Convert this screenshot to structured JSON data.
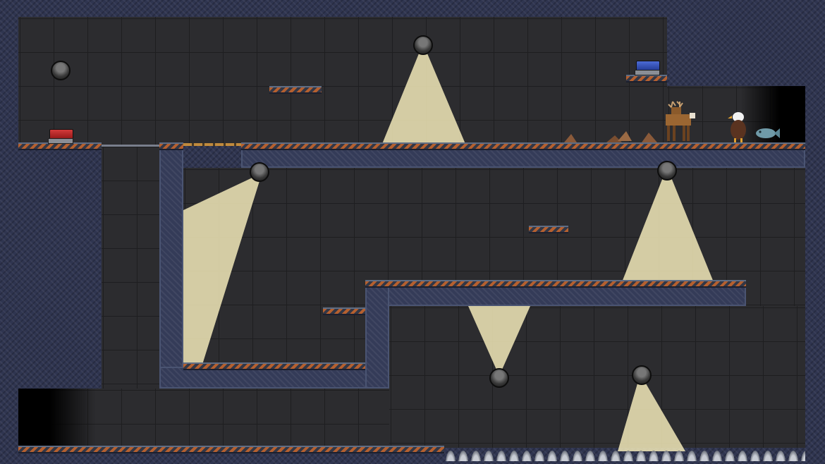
{
  "game": {
    "title": "",
    "scene": "facility-level",
    "colors": {
      "wall": "#2f3550",
      "room": "#2c2c2f",
      "light_beam": "#f2e9b8",
      "hazard_stripe": "#b5602f",
      "button_red": "#c42525",
      "button_blue": "#2f4fc0"
    }
  },
  "lamps": [
    {
      "name": "lamp-top-left",
      "state": "off"
    },
    {
      "name": "lamp-top-center",
      "state": "on"
    },
    {
      "name": "lamp-mid-left",
      "state": "on"
    },
    {
      "name": "lamp-mid-right",
      "state": "on"
    },
    {
      "name": "lamp-center-lower",
      "state": "on"
    },
    {
      "name": "lamp-bottom-right",
      "state": "on"
    }
  ],
  "switches": [
    {
      "name": "red-switch",
      "color": "red"
    },
    {
      "name": "blue-switch",
      "color": "blue"
    }
  ],
  "characters": [
    {
      "name": "deer",
      "icon": "deer-icon"
    },
    {
      "name": "eagle",
      "icon": "eagle-icon"
    },
    {
      "name": "fish",
      "icon": "fish-icon"
    }
  ],
  "hazards": [
    {
      "name": "spike-floor",
      "icon": "spikes-icon"
    }
  ]
}
